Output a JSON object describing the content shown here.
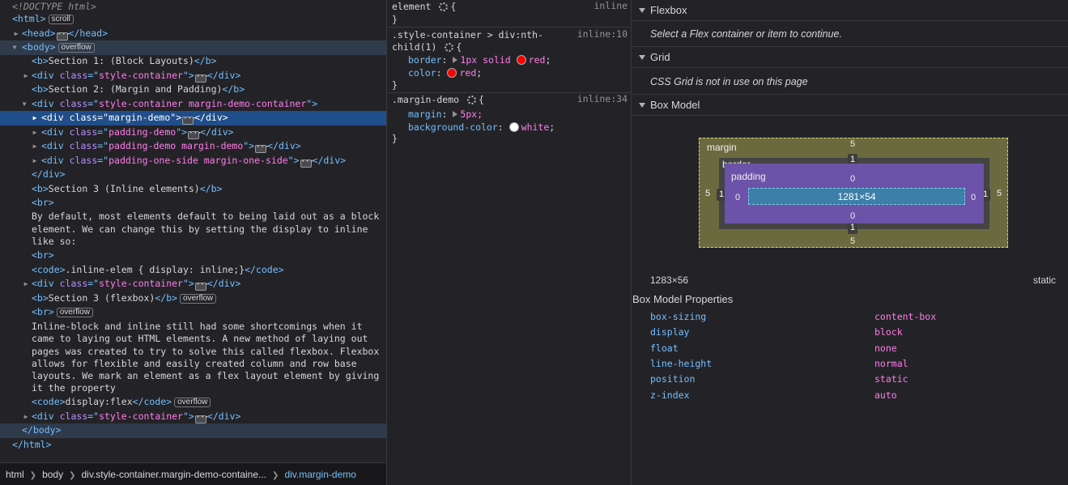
{
  "markup": {
    "doctype": "<!DOCTYPE html>",
    "html_open": "<html>",
    "html_badge": "scroll",
    "head": "<head>",
    "head_close": "</head>",
    "body_open": "<body>",
    "body_badge": "overflow",
    "b1": "Section 1: (Block Layouts)",
    "div_sc": "style-container",
    "b2": "Section 2: (Margin and Padding)",
    "div_mdc": "style-container margin-demo-container",
    "sel_class": "margin-demo",
    "pd": "padding-demo",
    "pdmd": "padding-demo margin-demo",
    "pos": "padding-one-side margin-one-side",
    "b3": "Section 3 (Inline elements)",
    "para1": [
      "By default, most elements default to being laid out as a block",
      "element. We can change this by setting the display to inline",
      "like so:"
    ],
    "code1": ".inline-elem { display: inline;}",
    "b4": "Section 3 (flexbox)",
    "b4_badge": "overflow",
    "br_badge": "overflow",
    "para2": [
      "Inline-block and inline still had some shortcomings when it",
      "came to laying out HTML elements. A new method of laying out",
      "pages was created to try to solve this called flexbox. Flexbox",
      "allows for flexible and easily created column and row base",
      "layouts. We mark an element as a flex layout element by giving",
      "it the property"
    ],
    "code2": "display:flex",
    "code2_badge": "overflow",
    "body_close": "</body>",
    "html_close": "</html>"
  },
  "breadcrumbs": [
    "html",
    "body",
    "div.style-container.margin-demo-containe...",
    "div.margin-demo"
  ],
  "rules": {
    "element": {
      "selector": "element",
      "source": "inline"
    },
    "nth": {
      "selector_1": ".style-container > div:nth-",
      "selector_2": "child(1)",
      "source": "inline:10",
      "decls": [
        {
          "name": "border",
          "value": "1px solid ",
          "color_name": "red",
          "swatch": "#ff0000"
        },
        {
          "name": "color",
          "value": "",
          "color_name": "red",
          "swatch": "#ff0000"
        }
      ]
    },
    "md": {
      "selector": ".margin-demo",
      "source": "inline:34",
      "decls": [
        {
          "name": "margin",
          "value": "5px;"
        },
        {
          "name": "background-color",
          "value": "",
          "color_name": "white",
          "swatch": "#ffffff"
        }
      ]
    }
  },
  "layout": {
    "flexbox": {
      "title": "Flexbox",
      "note": "Select a Flex container or item to continue."
    },
    "grid": {
      "title": "Grid",
      "note": "CSS Grid is not in use on this page"
    },
    "boxmodel": {
      "title": "Box Model",
      "margin_label": "margin",
      "border_label": "border",
      "padding_label": "padding",
      "margin": {
        "top": "5",
        "right": "5",
        "bottom": "5",
        "left": "5"
      },
      "border": {
        "top": "1",
        "right": "1",
        "bottom": "1",
        "left": "1"
      },
      "padding": {
        "top": "0",
        "right": "0",
        "bottom": "0",
        "left": "0"
      },
      "content": "1281×54",
      "size": "1283×56",
      "position": "static"
    },
    "props_title": "Box Model Properties",
    "props": [
      {
        "k": "box-sizing",
        "v": "content-box"
      },
      {
        "k": "display",
        "v": "block"
      },
      {
        "k": "float",
        "v": "none"
      },
      {
        "k": "line-height",
        "v": "normal"
      },
      {
        "k": "position",
        "v": "static"
      },
      {
        "k": "z-index",
        "v": "auto"
      }
    ]
  },
  "colors": {
    "selected_row": "#204e8a",
    "tag": "#75bfff",
    "attr": "#b98eff",
    "value": "#ff7de9"
  }
}
